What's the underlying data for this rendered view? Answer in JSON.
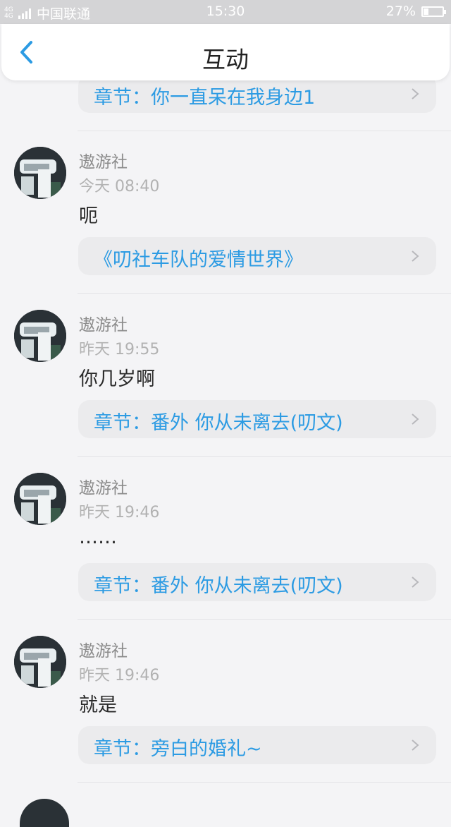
{
  "status_bar": {
    "signal_label": "4G 4G",
    "carrier": "中国联通",
    "time": "15:30",
    "battery": "27%",
    "battery_level": 0.27
  },
  "header": {
    "back_icon": "chevron-left-icon",
    "title": "互动"
  },
  "top_chip": {
    "text": "章节：你一直呆在我身边1"
  },
  "comments": [
    {
      "username": "遨游社",
      "time": "今天 08:40",
      "message": "呃",
      "link": "《叨社车队的爱情世界》"
    },
    {
      "username": "遨游社",
      "time": "昨天 19:55",
      "message": "你几岁啊",
      "link": "章节：番外 你从未离去(叨文)"
    },
    {
      "username": "遨游社",
      "time": "昨天 19:46",
      "message": "……",
      "link": "章节：番外 你从未离去(叨文)"
    },
    {
      "username": "遨游社",
      "time": "昨天 19:46",
      "message": "就是",
      "link": "章节：旁白的婚礼~"
    }
  ],
  "colors": {
    "accent": "#2c9be3",
    "background": "#f4f4f6",
    "chip_background": "#ebebed"
  }
}
